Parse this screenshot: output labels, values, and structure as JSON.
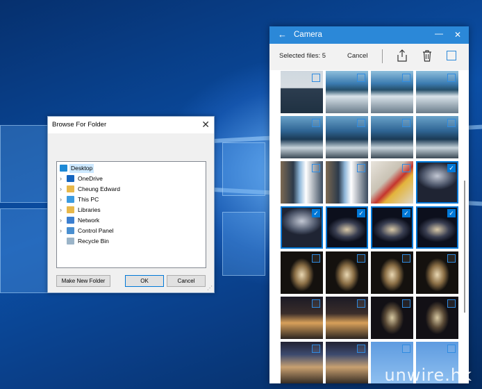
{
  "browse_dialog": {
    "title": "Browse For Folder",
    "tree": [
      {
        "label": "Desktop",
        "icon": "desktop-icon",
        "expandable": false,
        "selected": true,
        "indent": 0
      },
      {
        "label": "OneDrive",
        "icon": "onedrive-icon",
        "expandable": true,
        "selected": false,
        "indent": 1
      },
      {
        "label": "Cheung Edward",
        "icon": "user-folder-icon",
        "expandable": true,
        "selected": false,
        "indent": 1
      },
      {
        "label": "This PC",
        "icon": "pc-icon",
        "expandable": true,
        "selected": false,
        "indent": 1
      },
      {
        "label": "Libraries",
        "icon": "libraries-icon",
        "expandable": true,
        "selected": false,
        "indent": 1
      },
      {
        "label": "Network",
        "icon": "network-icon",
        "expandable": true,
        "selected": false,
        "indent": 1
      },
      {
        "label": "Control Panel",
        "icon": "control-panel-icon",
        "expandable": true,
        "selected": false,
        "indent": 1
      },
      {
        "label": "Recycle Bin",
        "icon": "recycle-bin-icon",
        "expandable": false,
        "selected": false,
        "indent": 1
      }
    ],
    "make_new_folder_label": "Make New Folder",
    "ok_label": "OK",
    "cancel_label": "Cancel"
  },
  "camera_app": {
    "title": "Camera",
    "selected_files_label": "Selected files: 5",
    "cancel_label": "Cancel",
    "accent_color": "#2b88d8",
    "photos": [
      {
        "style": "p-boat",
        "selected": false
      },
      {
        "style": "p-crowd",
        "selected": false
      },
      {
        "style": "p-crowd",
        "selected": false
      },
      {
        "style": "p-crowd",
        "selected": false
      },
      {
        "style": "p-crowd2",
        "selected": false
      },
      {
        "style": "p-crowd2",
        "selected": false
      },
      {
        "style": "p-crowd2",
        "selected": false
      },
      {
        "style": "p-crowd2",
        "selected": false
      },
      {
        "style": "p-shop",
        "selected": false
      },
      {
        "style": "p-shop",
        "selected": false
      },
      {
        "style": "p-toy",
        "selected": false
      },
      {
        "style": "p-gate",
        "selected": true
      },
      {
        "style": "p-gate",
        "selected": true
      },
      {
        "style": "p-gateN",
        "selected": true
      },
      {
        "style": "p-gateN",
        "selected": true
      },
      {
        "style": "p-gateN",
        "selected": true
      },
      {
        "style": "p-church",
        "selected": false
      },
      {
        "style": "p-church",
        "selected": false
      },
      {
        "style": "p-church",
        "selected": false
      },
      {
        "style": "p-church",
        "selected": false
      },
      {
        "style": "p-street",
        "selected": false
      },
      {
        "style": "p-street",
        "selected": false
      },
      {
        "style": "p-dome",
        "selected": false
      },
      {
        "style": "p-dome",
        "selected": false
      },
      {
        "style": "p-street2",
        "selected": false
      },
      {
        "style": "p-street2",
        "selected": false
      },
      {
        "style": "p-sky",
        "selected": false
      },
      {
        "style": "p-sky",
        "selected": false
      }
    ]
  },
  "watermark": "unwire.hk"
}
